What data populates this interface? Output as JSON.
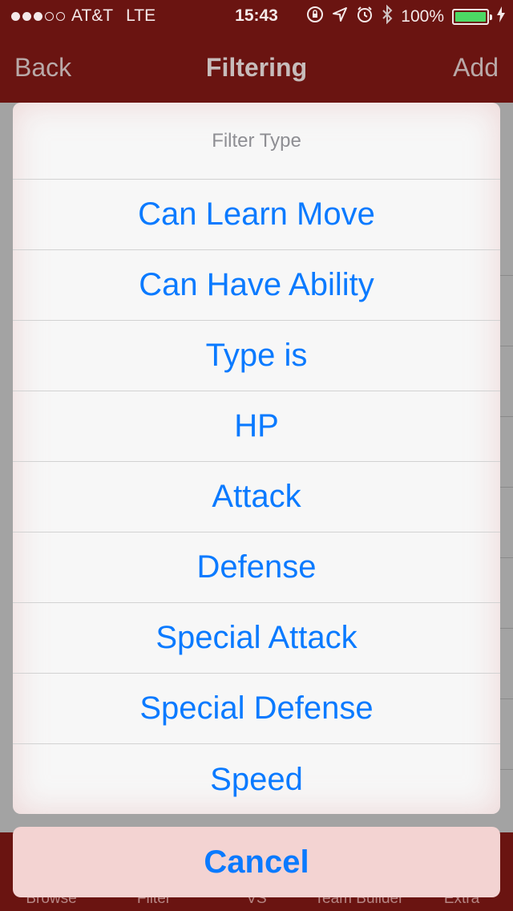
{
  "status_bar": {
    "carrier": "AT&T",
    "network": "LTE",
    "time": "15:43",
    "battery": "100%",
    "signal_bars": 3,
    "signal_total": 5
  },
  "nav": {
    "back_label": "Back",
    "title": "Filtering",
    "add_label": "Add"
  },
  "sheet": {
    "title": "Filter Type",
    "options": [
      "Can Learn Move",
      "Can Have Ability",
      "Type is",
      "HP",
      "Attack",
      "Defense",
      "Special Attack",
      "Special Defense",
      "Speed"
    ],
    "cancel_label": "Cancel"
  },
  "tabbar": {
    "tabs": [
      "Browse",
      "Filter",
      "VS",
      "Team Builder",
      "Extra"
    ]
  },
  "colors": {
    "nav_bg": "#6a1411",
    "accent": "#0a7aff",
    "battery_fill": "#4cd964"
  }
}
